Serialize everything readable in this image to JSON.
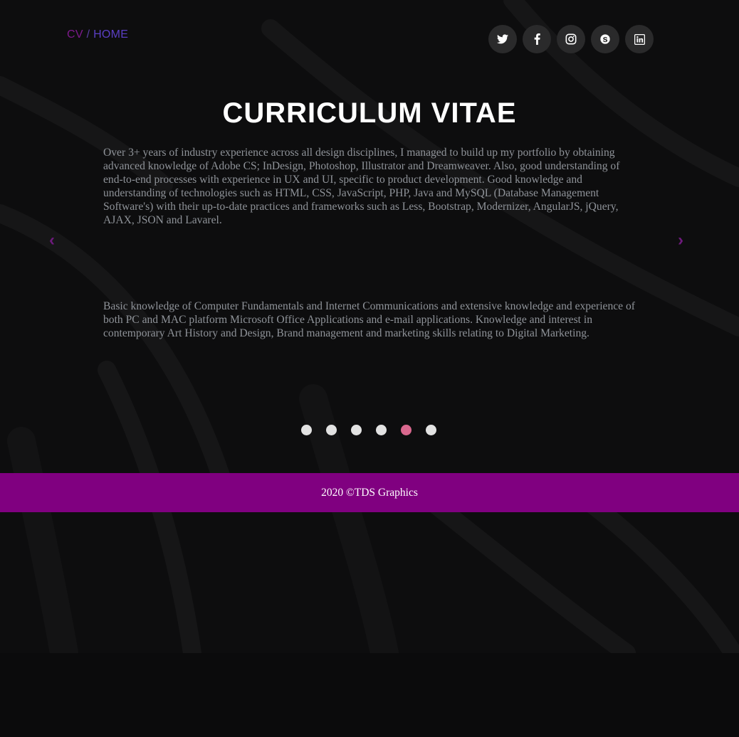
{
  "breadcrumb": {
    "cv": "CV",
    "separator": "/",
    "home": "HOME"
  },
  "social": [
    {
      "name": "twitter",
      "icon": "twitter-icon"
    },
    {
      "name": "facebook",
      "icon": "facebook-icon"
    },
    {
      "name": "instagram",
      "icon": "instagram-icon"
    },
    {
      "name": "skype",
      "icon": "skype-icon"
    },
    {
      "name": "linkedin",
      "icon": "linkedin-icon"
    }
  ],
  "header": {
    "title": "CURRICULUM VITAE"
  },
  "slide": {
    "paragraph1": "Over 3+ years of industry experience across all design disciplines, I managed to build up my portfolio by obtaining advanced knowledge of Adobe CS; InDesign, Photoshop, Illustrator and Dreamweaver. Also, good understanding of end-to-end processes with experience in UX and UI, specific to product development. Good knowledge and understanding of technologies such as HTML, CSS, JavaScript, PHP, Java and MySQL (Database Management Software's) with their up-to-date practices and frameworks such as Less, Bootstrap, Modernizer, AngularJS, jQuery, AJAX, JSON and Lavarel.",
    "paragraph2": "Basic knowledge of Computer Fundamentals and Internet Communications and extensive knowledge and experience of both PC and MAC platform Microsoft Office Applications and e-mail applications. Knowledge and interest in contemporary Art History and Design, Brand management and marketing skills relating to Digital Marketing."
  },
  "carousel": {
    "prev": "‹",
    "next": "›",
    "dot_count": 6,
    "active_index": 4
  },
  "footer": {
    "text": "2020 ©TDS Graphics"
  },
  "colors": {
    "accent": "#800080",
    "active_dot": "#d9688e",
    "dot": "#e2e2e2",
    "background": "#0c0c0d"
  }
}
